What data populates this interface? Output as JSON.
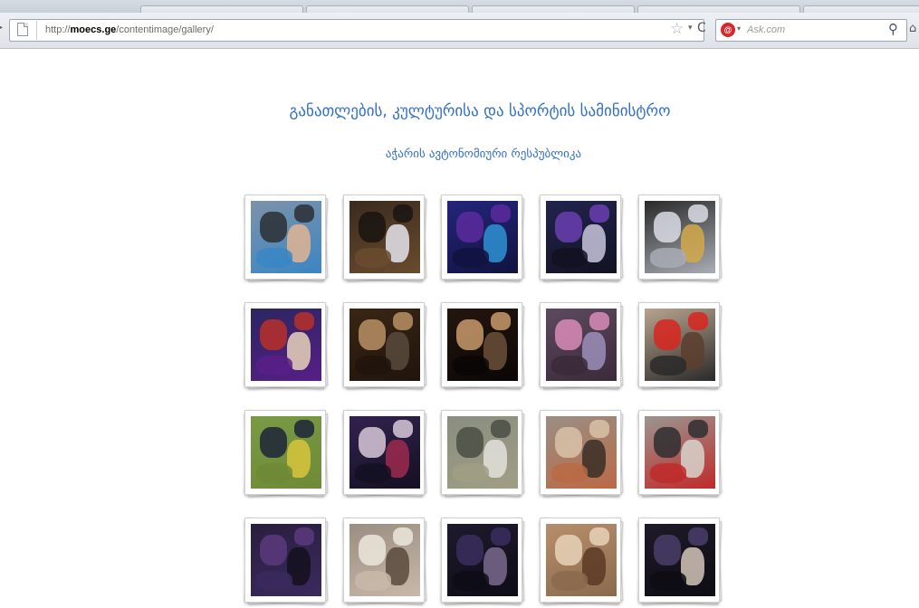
{
  "browser": {
    "url_prefix": "http://",
    "url_domain": "moecs.ge",
    "url_path": "/contentimage/gallery/",
    "search_placeholder": "Ask.com",
    "search_engine_icon": "ask-icon"
  },
  "page": {
    "title": "განათლების, კულტურისა და სპორტის სამინისტრო",
    "subtitle": "აჭარის ავტონომიური რესპუბლიკა"
  },
  "gallery": {
    "rows": [
      [
        {
          "bg": "#7d92a8",
          "a": "#2c2f34",
          "b": "#e0b494",
          "c": "#3a86c4"
        },
        {
          "bg": "#3a2a1e",
          "a": "#1a1410",
          "b": "#e4e4ec",
          "c": "#6a4c2e"
        },
        {
          "bg": "#24257a",
          "a": "#5c2a9e",
          "b": "#2e92d2",
          "c": "#111340"
        },
        {
          "bg": "#22244e",
          "a": "#6a3eb0",
          "b": "#c8c6dc",
          "c": "#121222"
        },
        {
          "bg": "#2a2a2a",
          "a": "#dadde6",
          "b": "#d2a94a",
          "c": "#a8acb4"
        }
      ],
      [
        {
          "bg": "#2a2660",
          "a": "#b83028",
          "b": "#e8d2b8",
          "c": "#581e88"
        },
        {
          "bg": "#3a2614",
          "a": "#b89066",
          "b": "#584a3c",
          "c": "#20140c"
        },
        {
          "bg": "#24160e",
          "a": "#c89a6c",
          "b": "#6a5038",
          "c": "#0a0606"
        },
        {
          "bg": "#5e4a5e",
          "a": "#d88cb8",
          "b": "#9c8eb8",
          "c": "#3a2a3a"
        },
        {
          "bg": "#b8a48e",
          "a": "#d8261e",
          "b": "#5a3e2e",
          "c": "#2a2a2a"
        }
      ],
      [
        {
          "bg": "#7a9a46",
          "a": "#1c2438",
          "b": "#d8c63c",
          "c": "#6e8a36"
        },
        {
          "bg": "#32224e",
          "a": "#d8c8d8",
          "b": "#9e2a4e",
          "c": "#141022"
        },
        {
          "bg": "#8a8e80",
          "a": "#4a4e44",
          "b": "#e2e2dc",
          "c": "#a09e84"
        },
        {
          "bg": "#9a8e86",
          "a": "#d8c2a8",
          "b": "#3a2e26",
          "c": "#ba6a44"
        },
        {
          "bg": "#9a9690",
          "a": "#2e2e30",
          "b": "#d8d4cc",
          "c": "#c02a2a"
        }
      ],
      [
        {
          "bg": "#2a1e3e",
          "a": "#5a3a7e",
          "b": "#14101c",
          "c": "#3a2a5e"
        },
        {
          "bg": "#9a8e82",
          "a": "#ece6dc",
          "b": "#5a4a3e",
          "c": "#c8b8a8"
        },
        {
          "bg": "#1e1a2e",
          "a": "#3a2e5e",
          "b": "#7a6a8e",
          "c": "#0e0c16"
        },
        {
          "bg": "#b88e6a",
          "a": "#e8d2b8",
          "b": "#5a3a26",
          "c": "#8a6a4e"
        },
        {
          "bg": "#1e1a28",
          "a": "#4a3e6a",
          "b": "#d2c6b8",
          "c": "#0e0c14"
        }
      ]
    ]
  }
}
